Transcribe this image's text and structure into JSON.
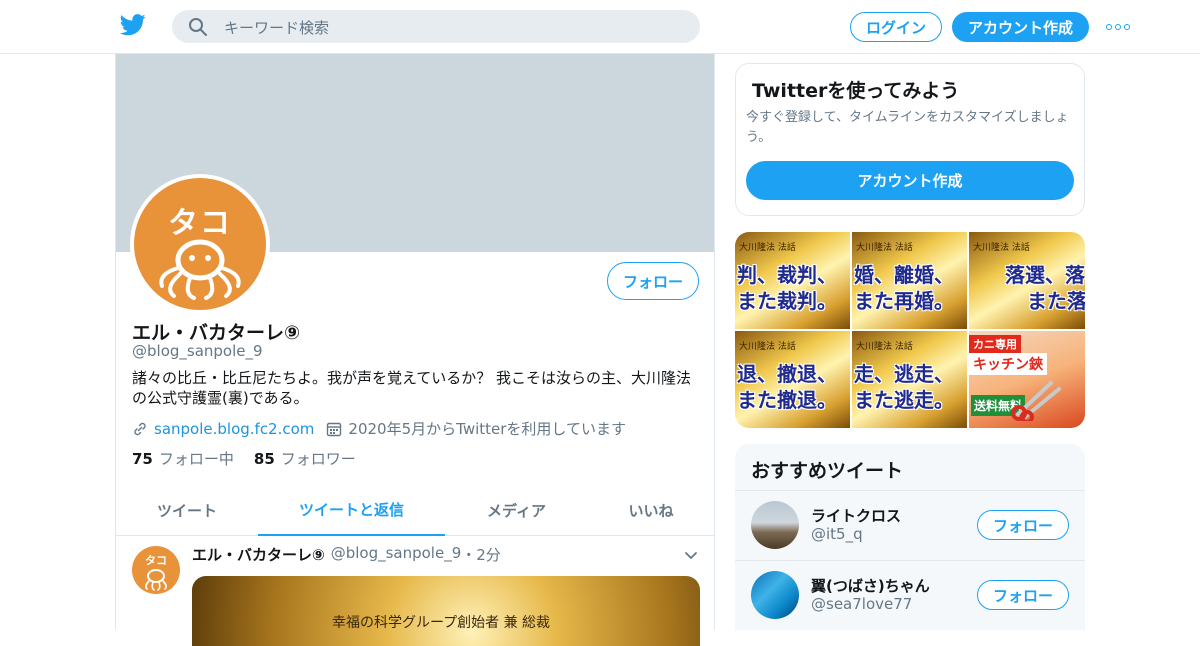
{
  "header": {
    "search_placeholder": "キーワード検索",
    "login_label": "ログイン",
    "signup_label": "アカウント作成"
  },
  "colors": {
    "accent": "#1da1f2",
    "banner": "#ccd6dd",
    "avatar_bg": "#e8923a"
  },
  "profile": {
    "avatar_text": "タコ",
    "follow_label": "フォロー",
    "name": "エル・バカターレ⑨",
    "handle": "@blog_sanpole_9",
    "bio": "諸々の比丘・比丘尼たちよ。我が声を覚えているか？ 我こそは汝らの主、大川隆法の公式守護霊(裏)である。",
    "website": "sanpole.blog.fc2.com",
    "joined": "2020年5月からTwitterを利用しています",
    "following_count": "75",
    "following_label": "フォロー中",
    "followers_count": "85",
    "followers_label": "フォロワー"
  },
  "tabs": [
    {
      "label": "ツイート"
    },
    {
      "label": "ツイートと返信"
    },
    {
      "label": "メディア"
    },
    {
      "label": "いいね"
    }
  ],
  "tweet": {
    "avatar_text": "タコ",
    "name": "エル・バカターレ⑨",
    "handle": "@blog_sanpole_9",
    "time": "・2分",
    "media_caption": "幸福の科学グループ創始者 兼 総裁"
  },
  "signup_card": {
    "title": "Twitterを使ってみよう",
    "text": "今すぐ登録して、タイムラインをカスタマイズしましょう。",
    "button": "アカウント作成"
  },
  "media_grid": [
    {
      "cap": "大川隆法 法話",
      "line1": "判、裁判、",
      "line2": "また裁判。"
    },
    {
      "cap": "大川隆法 法話",
      "line1": "婚、離婚、",
      "line2": "また再婚。"
    },
    {
      "cap": "大川隆法 法話",
      "line1": "落選、落選",
      "line2": "また落"
    },
    {
      "cap": "大川隆法 法話",
      "line1": "退、撤退、",
      "line2": "また撤退。"
    },
    {
      "cap": "大川隆法 法話",
      "line1": "走、逃走、",
      "line2": "また逃走。"
    },
    {
      "tag": "カニ専用",
      "tag2": "キッチン鋏",
      "stamp": "送料無料"
    }
  ],
  "recommended": {
    "title": "おすすめツイート",
    "users": [
      {
        "name": "ライトクロス",
        "handle": "@it5_q",
        "follow": "フォロー"
      },
      {
        "name": "翼(つばさ)ちゃん",
        "handle": "@sea7love77",
        "follow": "フォロー"
      }
    ]
  }
}
